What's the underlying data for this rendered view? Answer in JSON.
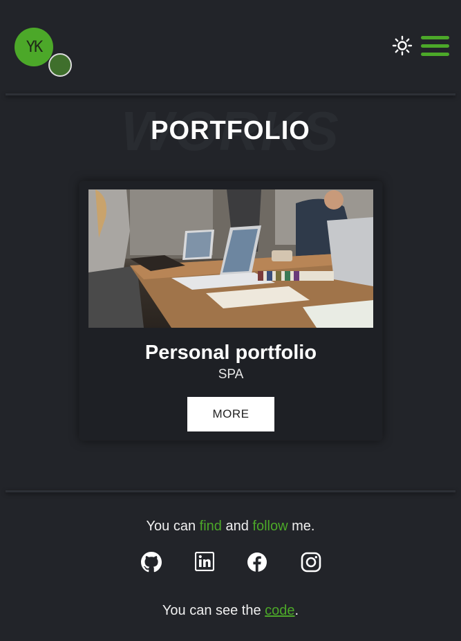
{
  "header": {
    "logo_text": "YK",
    "theme_icon": "sun-icon",
    "menu_icon": "hamburger-menu-icon"
  },
  "section": {
    "watermark": "WORKS",
    "title": "PORTFOLIO"
  },
  "project": {
    "title": "Personal portfolio",
    "subtitle": "SPA",
    "button_label": "MORE"
  },
  "footer": {
    "find_prefix": "You can ",
    "find_word": "find",
    "find_middle": " and ",
    "follow_word": "follow",
    "find_suffix": " me.",
    "socials": [
      "github-icon",
      "linkedin-icon",
      "facebook-icon",
      "instagram-icon"
    ],
    "code_prefix": "You can see the ",
    "code_link": "code",
    "code_suffix": "."
  },
  "colors": {
    "background": "#222429",
    "accent": "#4ca829",
    "card": "#1e2025",
    "button": "#ffffff"
  }
}
